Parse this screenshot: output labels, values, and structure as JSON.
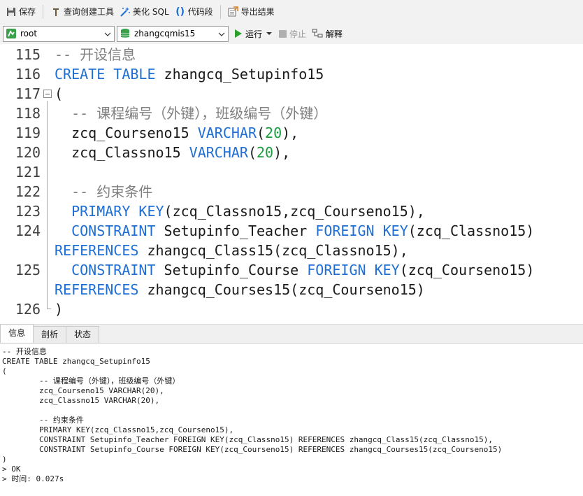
{
  "toolbar": {
    "save": "保存",
    "query_builder": "查询创建工具",
    "beautify_sql": "美化 SQL",
    "snippet": "代码段",
    "export": "导出结果"
  },
  "connection": {
    "user": "root",
    "database": "zhangcqmis15",
    "run": "运行",
    "stop": "停止",
    "explain": "解释"
  },
  "editor": {
    "lines": [
      {
        "num": "115",
        "segments": [
          {
            "t": "-- 开设信息",
            "c": "cm"
          }
        ]
      },
      {
        "num": "116",
        "segments": [
          {
            "t": "CREATE TABLE",
            "c": "kw"
          },
          {
            "t": " zhangcq_Setupinfo15",
            "c": ""
          }
        ]
      },
      {
        "num": "117",
        "segments": [
          {
            "t": "(",
            "c": ""
          }
        ]
      },
      {
        "num": "118",
        "segments": [
          {
            "t": "  -- 课程编号（外键），班级编号（外键）",
            "c": "cm"
          }
        ]
      },
      {
        "num": "119",
        "segments": [
          {
            "t": "  zcq_Courseno15 ",
            "c": ""
          },
          {
            "t": "VARCHAR",
            "c": "kw"
          },
          {
            "t": "(",
            "c": ""
          },
          {
            "t": "20",
            "c": "num"
          },
          {
            "t": "),",
            "c": ""
          }
        ]
      },
      {
        "num": "120",
        "segments": [
          {
            "t": "  zcq_Classno15 ",
            "c": ""
          },
          {
            "t": "VARCHAR",
            "c": "kw"
          },
          {
            "t": "(",
            "c": ""
          },
          {
            "t": "20",
            "c": "num"
          },
          {
            "t": "),",
            "c": ""
          }
        ]
      },
      {
        "num": "121",
        "segments": [
          {
            "t": "",
            "c": ""
          }
        ]
      },
      {
        "num": "122",
        "segments": [
          {
            "t": "  -- 约束条件",
            "c": "cm"
          }
        ]
      },
      {
        "num": "123",
        "segments": [
          {
            "t": "  PRIMARY KEY",
            "c": "kw"
          },
          {
            "t": "(zcq_Classno15,zcq_Courseno15),",
            "c": ""
          }
        ]
      },
      {
        "num": "124",
        "segments": [
          {
            "t": "  CONSTRAINT",
            "c": "kw"
          },
          {
            "t": " Setupinfo_Teacher ",
            "c": ""
          },
          {
            "t": "FOREIGN KEY",
            "c": "kw"
          },
          {
            "t": "(zcq_Classno15)",
            "c": ""
          }
        ]
      },
      {
        "num": "",
        "segments": [
          {
            "t": "REFERENCES",
            "c": "kw"
          },
          {
            "t": " zhangcq_Class15(zcq_Classno15),",
            "c": ""
          }
        ]
      },
      {
        "num": "125",
        "segments": [
          {
            "t": "  CONSTRAINT",
            "c": "kw"
          },
          {
            "t": " Setupinfo_Course ",
            "c": ""
          },
          {
            "t": "FOREIGN KEY",
            "c": "kw"
          },
          {
            "t": "(zcq_Courseno15)",
            "c": ""
          }
        ]
      },
      {
        "num": "",
        "segments": [
          {
            "t": "REFERENCES",
            "c": "kw"
          },
          {
            "t": " zhangcq_Courses15(zcq_Courseno15)",
            "c": ""
          }
        ]
      },
      {
        "num": "126",
        "segments": [
          {
            "t": ")",
            "c": ""
          }
        ]
      }
    ]
  },
  "tabs": [
    {
      "label": "信息",
      "active": true
    },
    {
      "label": "剖析",
      "active": false
    },
    {
      "label": "状态",
      "active": false
    }
  ],
  "output": {
    "lines": [
      "-- 开设信息",
      "CREATE TABLE zhangcq_Setupinfo15",
      "(",
      "        -- 课程编号（外键），班级编号（外键）",
      "        zcq_Courseno15 VARCHAR(20),",
      "        zcq_Classno15 VARCHAR(20),",
      "",
      "        -- 约束条件",
      "        PRIMARY KEY(zcq_Classno15,zcq_Courseno15),",
      "        CONSTRAINT Setupinfo_Teacher FOREIGN KEY(zcq_Classno15) REFERENCES zhangcq_Class15(zcq_Classno15),",
      "        CONSTRAINT Setupinfo_Course FOREIGN KEY(zcq_Courseno15) REFERENCES zhangcq_Courses15(zcq_Courseno15)",
      ")",
      "> OK",
      "> 时间: 0.027s"
    ]
  },
  "colors": {
    "keyword": "#1e6ed4",
    "number": "#1a9c3e",
    "comment": "#808080",
    "run_green": "#2ca02c"
  }
}
